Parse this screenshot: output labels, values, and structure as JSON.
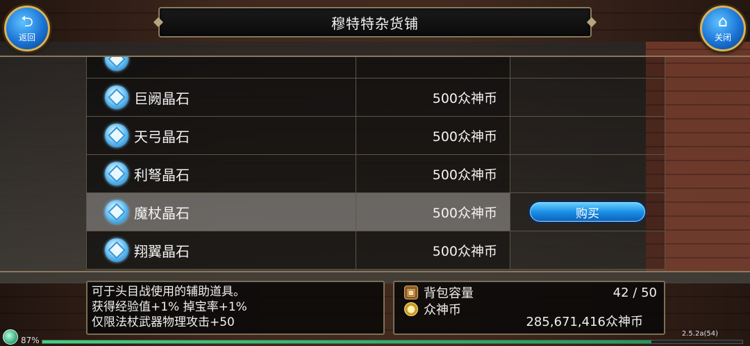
{
  "header": {
    "title": "穆特特杂货铺",
    "back_label": "返回",
    "close_label": "关闭",
    "back_icon": "return-arrow-icon",
    "close_icon": "home-icon"
  },
  "items": [
    {
      "name": "",
      "price": ""
    },
    {
      "name": "巨阙晶石",
      "price": "500众神币"
    },
    {
      "name": "天弓晶石",
      "price": "500众神币"
    },
    {
      "name": "利弩晶石",
      "price": "500众神币"
    },
    {
      "name": "魔杖晶石",
      "price": "500众神币",
      "selected": true,
      "action": "购买"
    },
    {
      "name": "翔翼晶石",
      "price": "500众神币"
    }
  ],
  "description": {
    "line1": "可于头目战使用的辅助道具。",
    "line2": "获得经验值+1% 掉宝率+1%",
    "line3": "仅限法杖武器物理攻击+50"
  },
  "inventory": {
    "bag_label": "背包容量",
    "bag_value": "42 / 50",
    "currency_label": "众神币",
    "currency_value": "285,671,416众神币"
  },
  "footer": {
    "percent": "87%",
    "version": "2.5.2a(54)",
    "exp_fraction": 0.87
  }
}
